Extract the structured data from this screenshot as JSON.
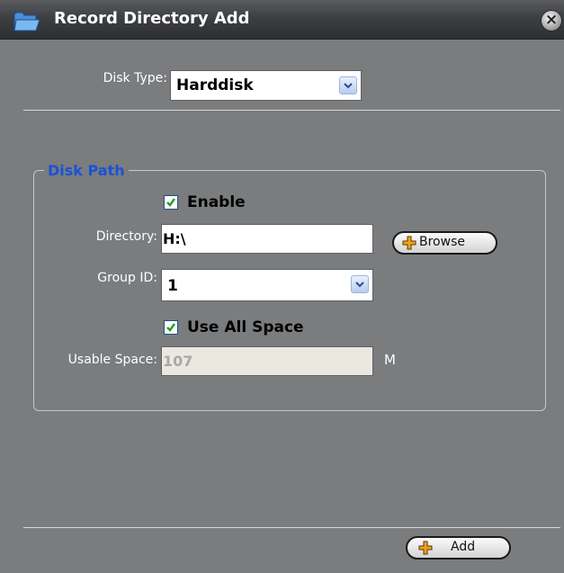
{
  "window": {
    "title": "Record Directory Add",
    "close_label": "×",
    "folder_icon": "folder-icon"
  },
  "disk_type": {
    "label": "Disk Type:",
    "value": "Harddisk"
  },
  "disk_path": {
    "legend": "Disk Path",
    "enable": {
      "label": "Enable",
      "checked": true
    },
    "directory": {
      "label": "Directory:",
      "value": "H:\\"
    },
    "browse_label": "Browse",
    "group_id": {
      "label": "Group ID:",
      "value": "1"
    },
    "use_all_space": {
      "label": "Use All Space",
      "checked": true
    },
    "usable_space": {
      "label": "Usable Space:",
      "value": "107",
      "unit": "M"
    }
  },
  "footer": {
    "add_label": "Add"
  },
  "colors": {
    "dialog_bg": "#7a7c7e",
    "legend": "#1a52d8",
    "plus_icon": "#f0a020"
  }
}
